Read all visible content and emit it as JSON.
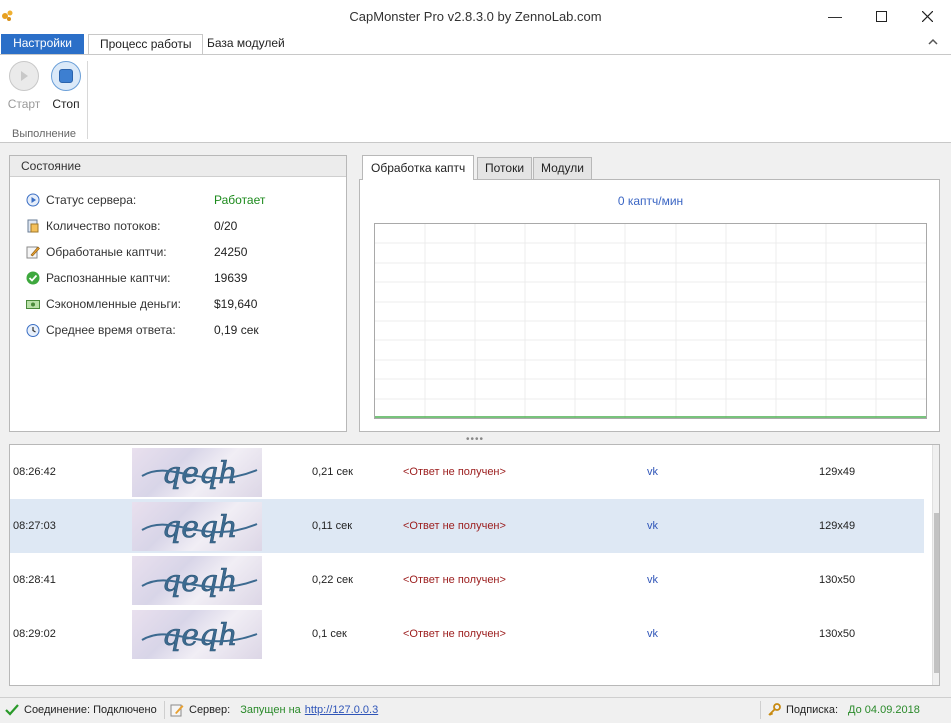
{
  "window": {
    "title": "CapMonster Pro v2.8.3.0 by ZennoLab.com"
  },
  "ribbon": {
    "file_tab": "Настройки",
    "tabs": [
      "Процесс работы",
      "База модулей"
    ],
    "buttons": {
      "start": "Старт",
      "stop": "Стоп"
    },
    "group_label": "Выполнение"
  },
  "state": {
    "header": "Состояние",
    "rows": [
      {
        "label": "Статус сервера:",
        "value": "Работает",
        "icon": "play-status-icon"
      },
      {
        "label": "Количество потоков:",
        "value": "0/20",
        "icon": "threads-icon"
      },
      {
        "label": "Обработаные каптчи:",
        "value": "24250",
        "icon": "edit-icon"
      },
      {
        "label": "Распознанные каптчи:",
        "value": "19639",
        "icon": "check-icon"
      },
      {
        "label": "Сэкономленные деньги:",
        "value": "$19,640",
        "icon": "money-icon"
      },
      {
        "label": "Среднее время ответа:",
        "value": "0,19 сек",
        "icon": "clock-icon"
      }
    ]
  },
  "chart_tabs": [
    "Обработка каптч",
    "Потоки",
    "Модули"
  ],
  "chart": {
    "rate": "0 каптч/мин"
  },
  "chart_data": {
    "type": "line",
    "title": "0 каптч/мин",
    "x": [],
    "series": [
      {
        "values": []
      }
    ],
    "grid": true
  },
  "log": {
    "rows": [
      {
        "time": "08:26:42",
        "duration": "0,21 сек",
        "answer": "<Ответ не получен>",
        "service": "vk",
        "size": "129x49"
      },
      {
        "time": "08:27:03",
        "duration": "0,11 сек",
        "answer": "<Ответ не получен>",
        "service": "vk",
        "size": "129x49"
      },
      {
        "time": "08:28:41",
        "duration": "0,22 сек",
        "answer": "<Ответ не получен>",
        "service": "vk",
        "size": "130x50"
      },
      {
        "time": "08:29:02",
        "duration": "0,1 сек",
        "answer": "<Ответ не получен>",
        "service": "vk",
        "size": "130x50"
      }
    ]
  },
  "statusbar": {
    "connection": "Соединение: Подключено",
    "server_label": "Сервер:",
    "server_value": "Запущен на",
    "server_link": "http://127.0.0.3",
    "subscription_label": "Подписка:",
    "subscription_value": "До 04.09.2018"
  }
}
